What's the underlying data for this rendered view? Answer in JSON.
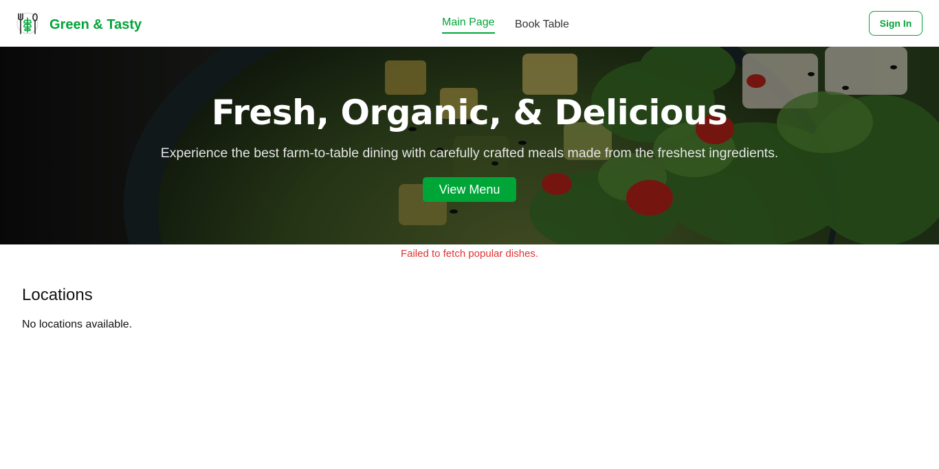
{
  "brand": {
    "name": "Green & Tasty",
    "accent": "#00a538",
    "logo_icon": "fork-spoon-leaf-icon"
  },
  "nav": {
    "items": [
      {
        "label": "Main Page",
        "active": true
      },
      {
        "label": "Book Table",
        "active": false
      }
    ]
  },
  "header": {
    "signin_label": "Sign In"
  },
  "hero": {
    "title": "Fresh, Organic, & Delicious",
    "subtitle": "Experience the best farm-to-table dining with carefully crafted meals made from the freshest ingredients.",
    "button_label": "View Menu",
    "background": "salad-bowl-photo"
  },
  "popular": {
    "error": "Failed to fetch popular dishes.",
    "error_color": "#e03131"
  },
  "locations": {
    "title": "Locations",
    "empty_text": "No locations available."
  }
}
